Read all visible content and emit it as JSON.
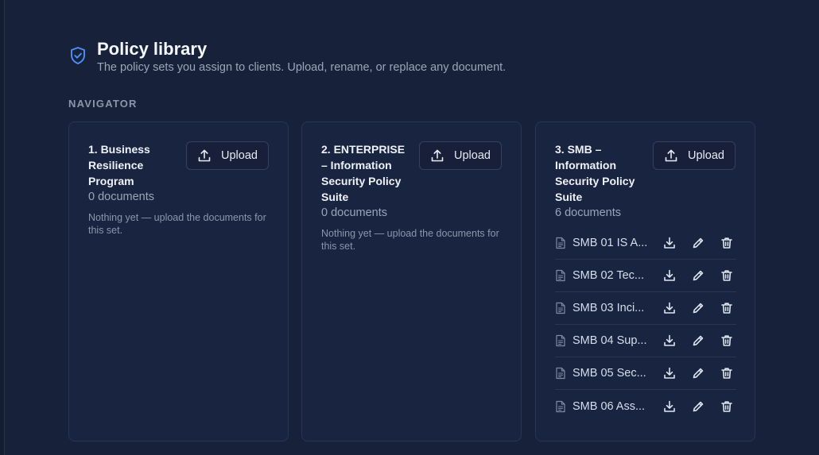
{
  "header": {
    "title": "Policy library",
    "subtitle": "The policy sets you assign to clients. Upload, rename, or replace any document."
  },
  "navigator_label": "NAVIGATOR",
  "cards": [
    {
      "title": "1. Business Resilience Program",
      "count": "0 documents",
      "upload_label": "Upload",
      "empty_note": "Nothing yet — upload the documents for this set."
    },
    {
      "title": "2. ENTERPRISE – Information Security Policy Suite",
      "count": "0 documents",
      "upload_label": "Upload",
      "empty_note": "Nothing yet — upload the documents for this set."
    },
    {
      "title": "3. SMB – Information Security Policy Suite",
      "count": "6 documents",
      "upload_label": "Upload",
      "documents": [
        {
          "name": "SMB 01 IS A..."
        },
        {
          "name": "SMB 02 Tec..."
        },
        {
          "name": "SMB 03 Inci..."
        },
        {
          "name": "SMB 04 Sup..."
        },
        {
          "name": "SMB 05 Sec..."
        },
        {
          "name": "SMB 06 Ass..."
        }
      ]
    }
  ],
  "icons": {
    "header": "shield-check-icon",
    "upload": "upload-icon",
    "document": "file-text-icon",
    "download": "download-icon",
    "rename": "pencil-icon",
    "delete": "trash-icon"
  },
  "colors": {
    "background": "#17213a",
    "card": "#192440",
    "accent": "#4f8ff7",
    "muted_text": "#9aa5b9"
  }
}
